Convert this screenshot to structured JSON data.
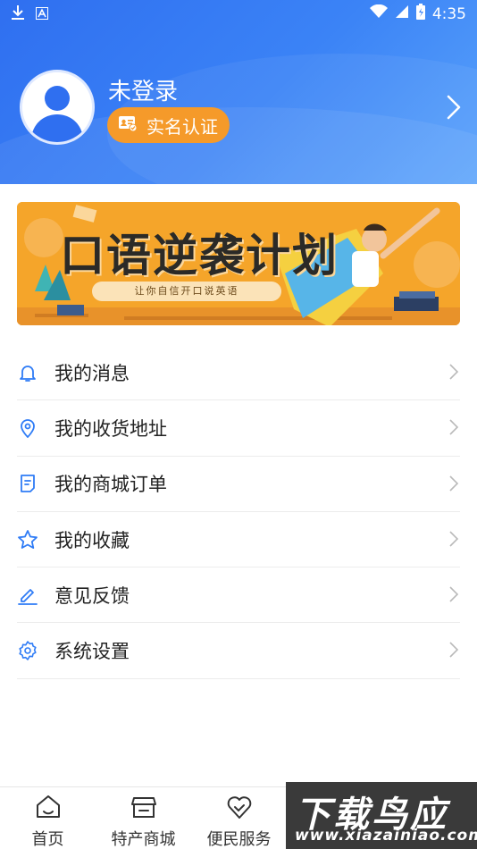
{
  "status_bar": {
    "time": "4:35"
  },
  "profile": {
    "name": "未登录",
    "verify_label": "实名认证"
  },
  "banner": {
    "title": "口语逆袭计划",
    "subtitle": "让你自信开口说英语"
  },
  "menu": [
    {
      "label": "我的消息",
      "icon": "bell-icon"
    },
    {
      "label": "我的收货地址",
      "icon": "location-pin-icon"
    },
    {
      "label": "我的商城订单",
      "icon": "order-doc-icon"
    },
    {
      "label": "我的收藏",
      "icon": "star-icon"
    },
    {
      "label": "意见反馈",
      "icon": "pen-icon"
    },
    {
      "label": "系统设置",
      "icon": "gear-icon"
    }
  ],
  "tabs": [
    {
      "label": "首页",
      "icon": "home-icon"
    },
    {
      "label": "特产商城",
      "icon": "store-icon"
    },
    {
      "label": "便民服务",
      "icon": "heart-hands-icon"
    }
  ],
  "watermark": {
    "big": "下载鸟应用",
    "small": "www.xiazainiao.com"
  },
  "colors": {
    "header": "#3b83f6",
    "accent": "#2f7cf6",
    "verify": "#f59a2a",
    "banner": "#f5a52a"
  }
}
